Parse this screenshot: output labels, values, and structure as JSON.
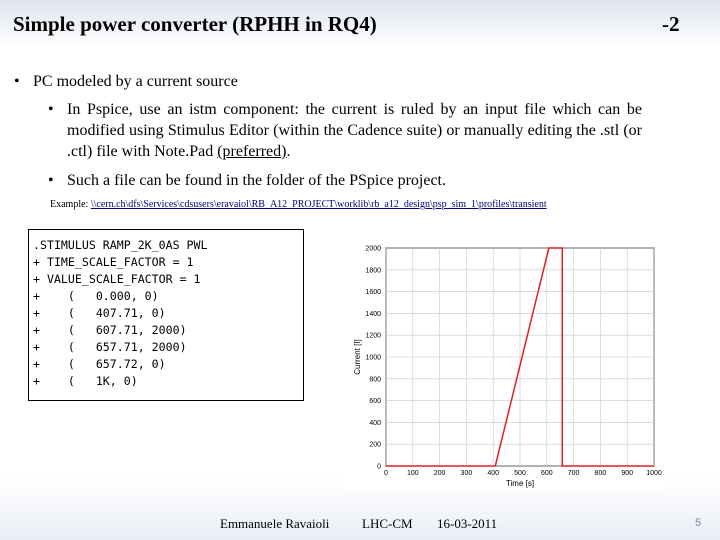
{
  "slide": {
    "title": "Simple power converter (RPHH in RQ4)",
    "tag": "-2",
    "bullet_glyph": "•",
    "bullets": [
      "PC modeled by a current source",
      "In Pspice, use an istm component: the current is ruled by an input file which can be modified using Stimulus Editor (within the Cadence suite) or manually editing the .stl (or .ctl) file with Note.Pad",
      "Such a file can be found in the folder of the PSpice project."
    ],
    "preferred_text": "(preferred)",
    "preferred_tail": ".",
    "example_label": "Example:",
    "example_path": "\\\\cern.ch\\dfs\\Services\\cdsusers\\eravaiol\\RB_A12_PROJECT\\worklib\\rb_a12_design\\psp_sim_1\\profiles\\transient",
    "code_lines": [
      ".STIMULUS RAMP_2K_0AS PWL",
      "+ TIME_SCALE_FACTOR = 1",
      "+ VALUE_SCALE_FACTOR = 1",
      "+    (   0.000, 0)",
      "+    (   407.71, 0)",
      "+    (   607.71, 2000)",
      "+    (   657.71, 2000)",
      "+    (   657.72, 0)",
      "+    (   1K, 0)"
    ]
  },
  "footer": {
    "author": "Emmanuele Ravaioli",
    "dept": "LHC-CM",
    "date": "16-03-2011",
    "page": "5"
  },
  "chart_data": {
    "type": "line",
    "xlabel": "Time [s]",
    "ylabel": "Current [I]",
    "xlim": [
      0,
      1000
    ],
    "ylim": [
      0,
      2000
    ],
    "xticks": [
      0,
      100,
      200,
      300,
      400,
      500,
      600,
      700,
      800,
      900,
      1000
    ],
    "xtick_labels": [
      "0",
      "100",
      "200",
      "300",
      "400",
      "500",
      "600",
      "700",
      "800",
      "900",
      "1000"
    ],
    "yticks": [
      0,
      200,
      400,
      600,
      800,
      1000,
      1200,
      1400,
      1600,
      1800,
      2000
    ],
    "ytick_labels": [
      "0",
      "200",
      "400",
      "600",
      "800",
      "1000",
      "1200",
      "1400",
      "1600",
      "1800",
      "2000"
    ],
    "grid": true,
    "line_color": "#e02020",
    "series": [
      {
        "x": [
          0,
          407.71,
          607.71,
          657.71,
          657.72,
          1000
        ],
        "y": [
          0,
          0,
          2000,
          2000,
          0,
          0
        ]
      }
    ]
  }
}
